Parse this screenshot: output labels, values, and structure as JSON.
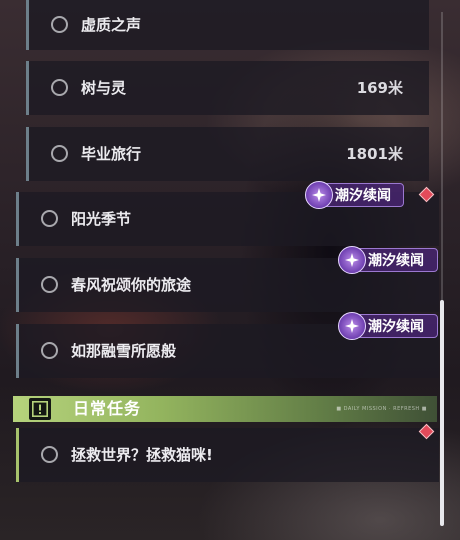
{
  "quests": [
    {
      "label": "虚质之声",
      "distance": ""
    },
    {
      "label": "树与灵",
      "distance": "169米"
    },
    {
      "label": "毕业旅行",
      "distance": "1801米"
    },
    {
      "label": "阳光季节",
      "distance": ""
    },
    {
      "label": "春风祝颂你的旅途",
      "distance": ""
    },
    {
      "label": "如那融雪所愿般",
      "distance": ""
    }
  ],
  "badges": {
    "b1": "潮汐续闻",
    "b2": "潮汐续闻",
    "b3": "潮汐续闻"
  },
  "section": {
    "title": "日常任务",
    "deco": "■ DAILY MISSION · REFRESH ■"
  },
  "daily": [
    {
      "label": "拯救世界？拯救猫咪!"
    }
  ],
  "colors": {
    "accent_green": "#a7c26c",
    "badge_purple": "#6e3fb0",
    "marker_red": "#e24a5a"
  },
  "icons": {
    "badge": "tide-sparkle-icon",
    "section": "exclamation-box-icon"
  }
}
